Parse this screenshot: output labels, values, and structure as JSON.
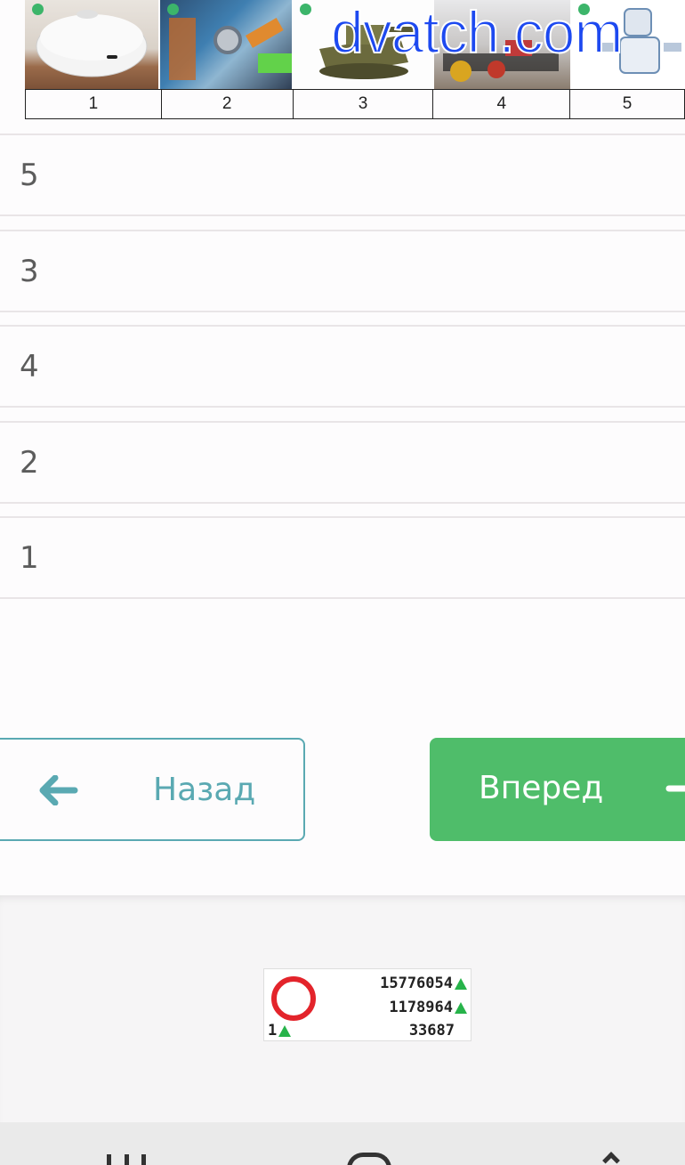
{
  "watermark": "dvatch.com",
  "image_strip": {
    "images": [
      {
        "icon": "robot-vacuum-image"
      },
      {
        "icon": "industrial-robot-arms-image"
      },
      {
        "icon": "toy-tank-image"
      },
      {
        "icon": "robot-kit-car-image"
      },
      {
        "icon": "humanoid-robot-image"
      }
    ],
    "numbers": [
      "1",
      "2",
      "3",
      "4",
      "5"
    ]
  },
  "answers": [
    "5",
    "3",
    "4",
    "2",
    "1"
  ],
  "buttons": {
    "back_label": "Назад",
    "next_label": "Вперед"
  },
  "counter": {
    "line1": "15776054",
    "line2": "1178964",
    "line3": "33687",
    "left": "1"
  },
  "colors": {
    "accent_teal": "#5aa9b2",
    "next_green": "#4fbd6a",
    "watermark_blue": "#1d49f0"
  }
}
